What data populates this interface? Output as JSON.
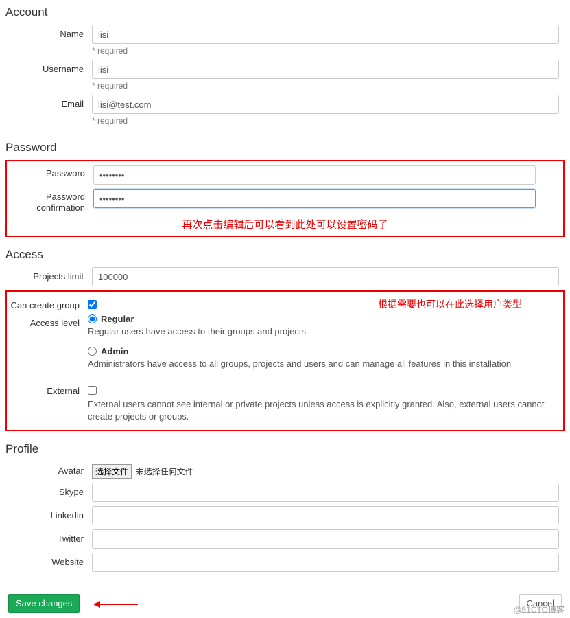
{
  "sections": {
    "account": {
      "title": "Account",
      "name_label": "Name",
      "name_value": "lisi",
      "username_label": "Username",
      "username_value": "lisi",
      "email_label": "Email",
      "email_value": "lisi@test.com",
      "required_text": "* required"
    },
    "password": {
      "title": "Password",
      "password_label": "Password",
      "password_value": "••••••••",
      "confirm_label": "Password confirmation",
      "confirm_value": "••••••••",
      "annotation": "再次点击编辑后可以看到此处可以设置密码了"
    },
    "access": {
      "title": "Access",
      "projects_limit_label": "Projects limit",
      "projects_limit_value": "100000",
      "can_create_group_label": "Can create group",
      "can_create_group_checked": true,
      "access_level_label": "Access level",
      "regular_label": "Regular",
      "regular_desc": "Regular users have access to their groups and projects",
      "admin_label": "Admin",
      "admin_desc": "Administrators have access to all groups, projects and users and can manage all features in this installation",
      "external_label": "External",
      "external_desc": "External users cannot see internal or private projects unless access is explicitly granted. Also, external users cannot create projects or groups.",
      "annotation": "根据需要也可以在此选择用户类型"
    },
    "profile": {
      "title": "Profile",
      "avatar_label": "Avatar",
      "file_btn": "选择文件",
      "file_status": "未选择任何文件",
      "skype_label": "Skype",
      "linkedin_label": "Linkedin",
      "twitter_label": "Twitter",
      "website_label": "Website"
    }
  },
  "buttons": {
    "save": "Save changes",
    "cancel": "Cancel"
  },
  "watermark": "@51CTO博客"
}
